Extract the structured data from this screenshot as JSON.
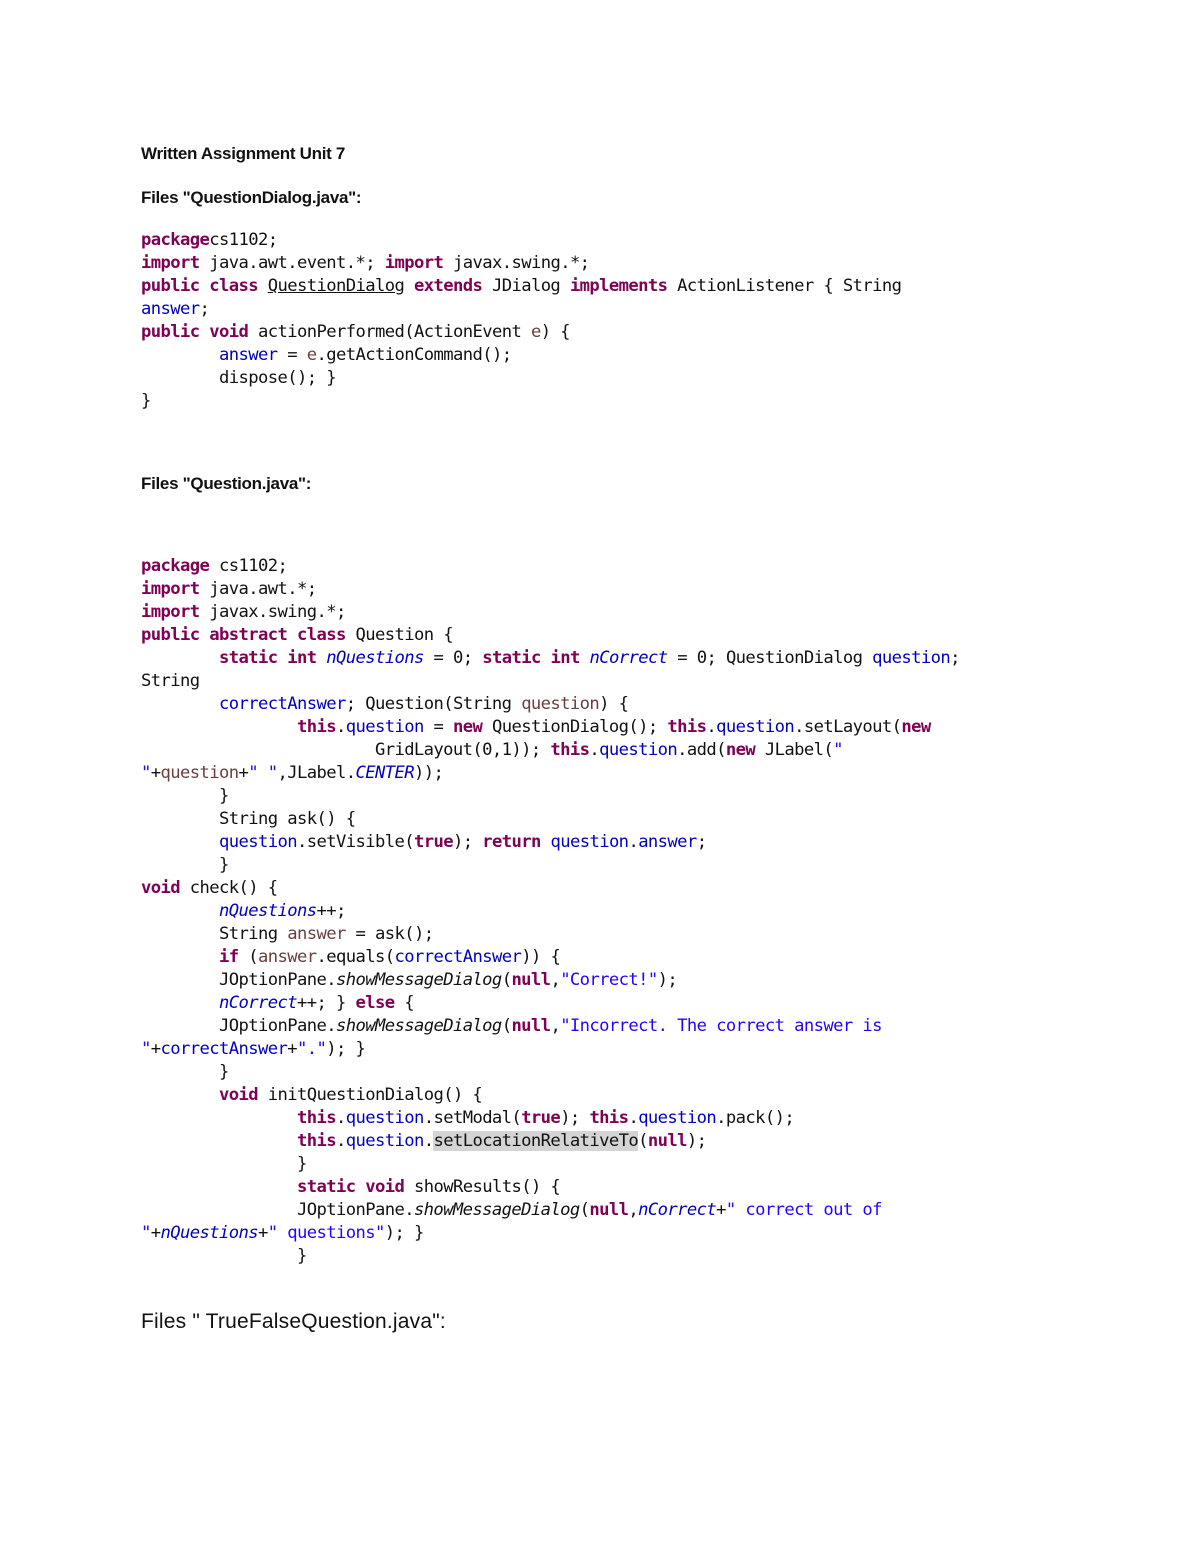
{
  "document": {
    "title": "Written Assignment Unit 7",
    "sections": [
      {
        "heading": "Files \"QuestionDialog.java\":",
        "code": [
          [
            [
              "kw",
              "package"
            ],
            [
              "",
              "cs1102;"
            ]
          ],
          [
            [
              "kw",
              "import"
            ],
            [
              "",
              " java.awt.event.*; "
            ],
            [
              "kw",
              "import"
            ],
            [
              "",
              " javax.swing.*;"
            ]
          ],
          [
            [
              "kw",
              "public"
            ],
            [
              "",
              " "
            ],
            [
              "kw",
              "class"
            ],
            [
              "",
              " "
            ],
            [
              "und",
              "QuestionDialog"
            ],
            [
              "",
              " "
            ],
            [
              "kw",
              "extends"
            ],
            [
              "",
              " JDialog "
            ],
            [
              "kw",
              "implements"
            ],
            [
              "",
              " ActionListener { String"
            ]
          ],
          [
            [
              "fld",
              "answer"
            ],
            [
              "",
              ";"
            ]
          ],
          [
            [
              "kw",
              "public"
            ],
            [
              "",
              " "
            ],
            [
              "kw",
              "void"
            ],
            [
              "",
              " actionPerformed(ActionEvent "
            ],
            [
              "loc",
              "e"
            ],
            [
              "",
              ") {"
            ]
          ],
          [
            [
              "",
              "        "
            ],
            [
              "fld",
              "answer"
            ],
            [
              "",
              " = "
            ],
            [
              "loc",
              "e"
            ],
            [
              "",
              ".getActionCommand();"
            ]
          ],
          [
            [
              "",
              "        dispose(); }"
            ]
          ],
          [
            [
              "",
              "}"
            ]
          ]
        ]
      },
      {
        "heading": "Files \"Question.java\":",
        "code": [
          [
            [
              "kw",
              "package"
            ],
            [
              "",
              " cs1102;"
            ]
          ],
          [
            [
              "kw",
              "import"
            ],
            [
              "",
              " java.awt.*;"
            ]
          ],
          [
            [
              "kw",
              "import"
            ],
            [
              "",
              " javax.swing.*;"
            ]
          ],
          [
            [
              "kw",
              "public"
            ],
            [
              "",
              " "
            ],
            [
              "kw",
              "abstract"
            ],
            [
              "",
              " "
            ],
            [
              "kw",
              "class"
            ],
            [
              "",
              " Question {"
            ]
          ],
          [
            [
              "",
              "        "
            ],
            [
              "kw",
              "static"
            ],
            [
              "",
              " "
            ],
            [
              "kw",
              "int"
            ],
            [
              "",
              " "
            ],
            [
              "sfld",
              "nQuestions"
            ],
            [
              "",
              " = 0; "
            ],
            [
              "kw",
              "static"
            ],
            [
              "",
              " "
            ],
            [
              "kw",
              "int"
            ],
            [
              "",
              " "
            ],
            [
              "sfld",
              "nCorrect"
            ],
            [
              "",
              " = 0; QuestionDialog "
            ],
            [
              "fld",
              "question"
            ],
            [
              "",
              ";"
            ]
          ],
          [
            [
              "",
              "String"
            ]
          ],
          [
            [
              "",
              "        "
            ],
            [
              "fld",
              "correctAnswer"
            ],
            [
              "",
              "; Question(String "
            ],
            [
              "loc",
              "question"
            ],
            [
              "",
              ") {"
            ]
          ],
          [
            [
              "",
              "                "
            ],
            [
              "kw",
              "this"
            ],
            [
              "",
              "."
            ],
            [
              "fld",
              "question"
            ],
            [
              "",
              " = "
            ],
            [
              "kw",
              "new"
            ],
            [
              "",
              " QuestionDialog(); "
            ],
            [
              "kw",
              "this"
            ],
            [
              "",
              "."
            ],
            [
              "fld",
              "question"
            ],
            [
              "",
              ".setLayout("
            ],
            [
              "kw",
              "new"
            ]
          ],
          [
            [
              "",
              "                        GridLayout(0,1)); "
            ],
            [
              "kw",
              "this"
            ],
            [
              "",
              "."
            ],
            [
              "fld",
              "question"
            ],
            [
              "",
              ".add("
            ],
            [
              "kw",
              "new"
            ],
            [
              "",
              " JLabel("
            ],
            [
              "str",
              "\""
            ]
          ],
          [
            [
              "str",
              "\""
            ],
            [
              "",
              "+"
            ],
            [
              "loc",
              "question"
            ],
            [
              "",
              "+"
            ],
            [
              "str",
              "\" \""
            ],
            [
              "",
              ",JLabel."
            ],
            [
              "sfld",
              "CENTER"
            ],
            [
              "",
              "));"
            ]
          ],
          [
            [
              "",
              "        }"
            ]
          ],
          [
            [
              "",
              "        String ask() {"
            ]
          ],
          [
            [
              "",
              "        "
            ],
            [
              "fld",
              "question"
            ],
            [
              "",
              ".setVisible("
            ],
            [
              "kw",
              "true"
            ],
            [
              "",
              "); "
            ],
            [
              "kw",
              "return"
            ],
            [
              "",
              " "
            ],
            [
              "fld",
              "question"
            ],
            [
              "",
              "."
            ],
            [
              "fld",
              "answer"
            ],
            [
              "",
              ";"
            ]
          ],
          [
            [
              "",
              "        }"
            ]
          ],
          [
            [
              "kw",
              "void"
            ],
            [
              "",
              " check() {"
            ]
          ],
          [
            [
              "",
              "        "
            ],
            [
              "sfld",
              "nQuestions"
            ],
            [
              "",
              "++;"
            ]
          ],
          [
            [
              "",
              "        String "
            ],
            [
              "loc",
              "answer"
            ],
            [
              "",
              " = ask();"
            ]
          ],
          [
            [
              "",
              "        "
            ],
            [
              "kw",
              "if"
            ],
            [
              "",
              " ("
            ],
            [
              "loc",
              "answer"
            ],
            [
              "",
              ".equals("
            ],
            [
              "fld",
              "correctAnswer"
            ],
            [
              "",
              ")) {"
            ]
          ],
          [
            [
              "",
              "        JOptionPane."
            ],
            [
              "ital",
              "showMessageDialog"
            ],
            [
              "",
              "("
            ],
            [
              "kw",
              "null"
            ],
            [
              "",
              ","
            ],
            [
              "str",
              "\"Correct!\""
            ],
            [
              "",
              ");"
            ]
          ],
          [
            [
              "",
              "        "
            ],
            [
              "sfld",
              "nCorrect"
            ],
            [
              "",
              "++; } "
            ],
            [
              "kw",
              "else"
            ],
            [
              "",
              " {"
            ]
          ],
          [
            [
              "",
              "        JOptionPane."
            ],
            [
              "ital",
              "showMessageDialog"
            ],
            [
              "",
              "("
            ],
            [
              "kw",
              "null"
            ],
            [
              "",
              ","
            ],
            [
              "str",
              "\"Incorrect. The correct answer is"
            ]
          ],
          [
            [
              "str",
              "\""
            ],
            [
              "",
              "+"
            ],
            [
              "fld",
              "correctAnswer"
            ],
            [
              "",
              "+"
            ],
            [
              "str",
              "\".\""
            ],
            [
              "",
              "); }"
            ]
          ],
          [
            [
              "",
              "        }"
            ]
          ],
          [
            [
              "",
              "        "
            ],
            [
              "kw",
              "void"
            ],
            [
              "",
              " initQuestionDialog() {"
            ]
          ],
          [
            [
              "",
              "                "
            ],
            [
              "kw",
              "this"
            ],
            [
              "",
              "."
            ],
            [
              "fld",
              "question"
            ],
            [
              "",
              ".setModal("
            ],
            [
              "kw",
              "true"
            ],
            [
              "",
              "); "
            ],
            [
              "kw",
              "this"
            ],
            [
              "",
              "."
            ],
            [
              "fld",
              "question"
            ],
            [
              "",
              ".pack();"
            ]
          ],
          [
            [
              "",
              "                "
            ],
            [
              "kw",
              "this"
            ],
            [
              "",
              "."
            ],
            [
              "fld",
              "question"
            ],
            [
              "",
              "."
            ],
            [
              "hl",
              "setLocationRelativeTo"
            ],
            [
              "",
              "("
            ],
            [
              "kw",
              "null"
            ],
            [
              "",
              ");"
            ]
          ],
          [
            [
              "",
              "                }"
            ]
          ],
          [
            [
              "",
              "                "
            ],
            [
              "kw",
              "static"
            ],
            [
              "",
              " "
            ],
            [
              "kw",
              "void"
            ],
            [
              "",
              " showResults() {"
            ]
          ],
          [
            [
              "",
              "                JOptionPane."
            ],
            [
              "ital",
              "showMessageDialog"
            ],
            [
              "",
              "("
            ],
            [
              "kw",
              "null"
            ],
            [
              "",
              ","
            ],
            [
              "sfld",
              "nCorrect"
            ],
            [
              "",
              "+"
            ],
            [
              "str",
              "\" correct out of"
            ]
          ],
          [
            [
              "str",
              "\""
            ],
            [
              "",
              "+"
            ],
            [
              "sfld",
              "nQuestions"
            ],
            [
              "",
              "+"
            ],
            [
              "str",
              "\" questions\""
            ],
            [
              "",
              "); }"
            ]
          ],
          [
            [
              "",
              "                }"
            ]
          ]
        ]
      },
      {
        "heading": "Files \" TrueFalseQuestion.java\":",
        "code": []
      }
    ]
  },
  "colors": {
    "keyword": "#7f0055",
    "field": "#0000c0",
    "string": "#2a00ff",
    "local": "#6a3e3e",
    "highlight": "#d4d4d4"
  }
}
